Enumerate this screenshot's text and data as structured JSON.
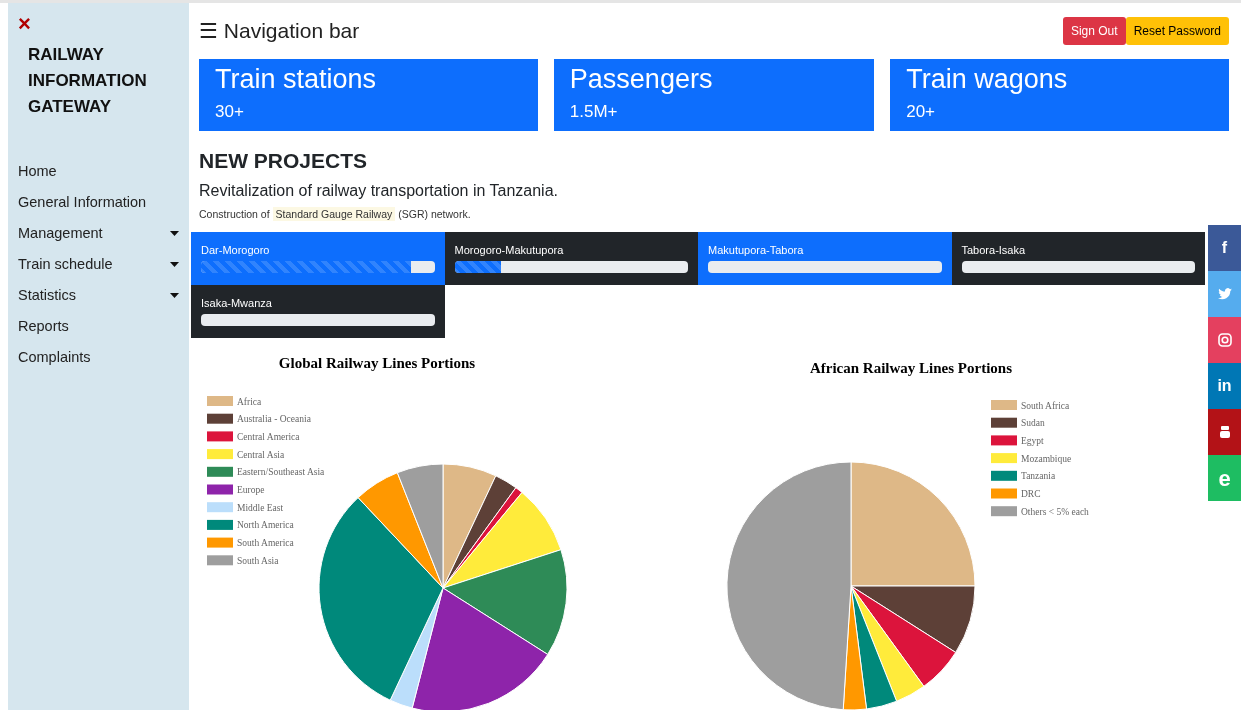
{
  "sidebar": {
    "close": "×",
    "brand": "RAILWAY INFORMATION GATEWAY",
    "items": [
      {
        "label": "Home",
        "has_submenu": false
      },
      {
        "label": "General Information",
        "has_submenu": false
      },
      {
        "label": "Management",
        "has_submenu": true
      },
      {
        "label": "Train schedule",
        "has_submenu": true
      },
      {
        "label": "Statistics",
        "has_submenu": true
      },
      {
        "label": "Reports",
        "has_submenu": false
      },
      {
        "label": "Complaints",
        "has_submenu": false
      }
    ]
  },
  "navbar": {
    "toggle": "☰",
    "title": "Navigation bar",
    "buttons": [
      {
        "label": "Sign Out",
        "kind": "danger"
      },
      {
        "label": "Reset Password",
        "kind": "warning"
      }
    ]
  },
  "stats": [
    {
      "title": "Train stations",
      "value": "30+"
    },
    {
      "title": "Passengers",
      "value": "1.5M+"
    },
    {
      "title": "Train wagons",
      "value": "20+"
    }
  ],
  "projects": {
    "heading": "NEW PROJECTS",
    "lead": "Revitalization of railway transportation in Tanzania.",
    "note": "Construction of ",
    "highlight": "Standard Gauge Railway",
    "note_end": " (SGR) network."
  },
  "sections": [
    {
      "name": "Dar-Morogoro",
      "color": "#0d6efd",
      "level": 0.9
    },
    {
      "name": "Morogoro-Makutupora",
      "color": "#212529",
      "level": 0.2
    },
    {
      "name": "Makutupora-Tabora",
      "color": "#0d6efd",
      "level": 0
    },
    {
      "name": "Tabora-Isaka",
      "color": "#212529",
      "level": 0
    },
    {
      "name": "Isaka-Mwanza",
      "color": "#212529",
      "level": 0
    }
  ],
  "charts": [
    {
      "chart_data": {
        "type": "pie",
        "title": "Global Railway Lines Portions",
        "categories": [
          "Africa",
          "Australia - Oceania",
          "Central America",
          "Central Asia",
          "Eastern/Southeast Asia",
          "Europe",
          "Middle East",
          "North America",
          "South America",
          "South Asia"
        ],
        "series": [
          {
            "values": [
              7,
              3,
              1,
              9,
              14,
              20,
              3,
              31,
              6,
              6
            ]
          }
        ],
        "legend": "upper left"
      },
      "slices": [
        {
          "color": "#deb887"
        },
        {
          "color": "#5d4037"
        },
        {
          "color": "#dc143c"
        },
        {
          "color": "#ffeb3b"
        },
        {
          "color": "#2e8b57"
        },
        {
          "color": "#8e24aa"
        },
        {
          "color": "#bbdefb"
        },
        {
          "color": "#00897b"
        },
        {
          "color": "#ff9800"
        },
        {
          "color": "#9e9e9e"
        }
      ]
    },
    {
      "chart_data": {
        "type": "pie",
        "title": "African Railway Lines Portions",
        "categories": [
          "South Africa",
          "Sudan",
          "Egypt",
          "Mozambique",
          "Tanzania",
          "DRC",
          "Others < 5% each"
        ],
        "series": [
          {
            "values": [
              25,
              9,
              6,
              4,
              4,
              3,
              49
            ]
          }
        ],
        "legend": "upper right"
      },
      "slices": [
        {
          "color": "#deb887"
        },
        {
          "color": "#5d4037"
        },
        {
          "color": "#dc143c"
        },
        {
          "color": "#ffeb3b"
        },
        {
          "color": "#00897b"
        },
        {
          "color": "#ff9800"
        },
        {
          "color": "#9e9e9e"
        }
      ]
    }
  ],
  "social": [
    {
      "kind": "facebook",
      "glyph": "f",
      "color": "#3b5998"
    },
    {
      "kind": "twitter",
      "color": "#55acee"
    },
    {
      "kind": "instagram",
      "color": "#e4405f"
    },
    {
      "kind": "linkedin",
      "glyph": "in",
      "color": "#0077b5"
    },
    {
      "kind": "youtube",
      "color": "#b31217"
    },
    {
      "kind": "edge",
      "glyph": "e",
      "color": "#1ebd62"
    }
  ]
}
